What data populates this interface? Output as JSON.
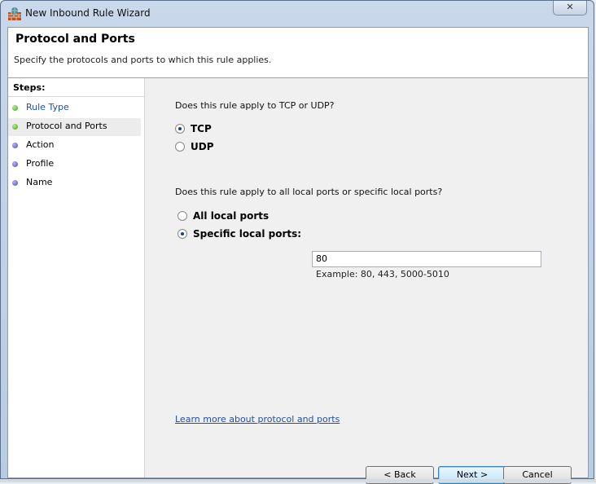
{
  "window": {
    "title": "New Inbound Rule Wizard",
    "close_glyph": "✕"
  },
  "header": {
    "title": "Protocol and Ports",
    "subtitle": "Specify the protocols and ports to which this rule applies."
  },
  "steps": {
    "label": "Steps:",
    "items": [
      {
        "label": "Rule Type",
        "status": "completed",
        "link": true
      },
      {
        "label": "Protocol and Ports",
        "status": "current",
        "link": false
      },
      {
        "label": "Action",
        "status": "pending",
        "link": false
      },
      {
        "label": "Profile",
        "status": "pending",
        "link": false
      },
      {
        "label": "Name",
        "status": "pending",
        "link": false
      }
    ]
  },
  "protocol": {
    "question": "Does this rule apply to TCP or UDP?",
    "options": [
      {
        "label": "TCP",
        "checked": true
      },
      {
        "label": "UDP",
        "checked": false
      }
    ]
  },
  "ports": {
    "question": "Does this rule apply to all local ports or specific local ports?",
    "options": [
      {
        "label": "All local ports",
        "checked": false
      },
      {
        "label": "Specific local ports:",
        "checked": true
      }
    ],
    "value": "80",
    "example": "Example: 80, 443, 5000-5010"
  },
  "learn_more": "Learn more about protocol and ports",
  "buttons": {
    "back": "< Back",
    "next": "Next >",
    "cancel": "Cancel"
  },
  "colors": {
    "link": "#1f4fa6",
    "completed_dot": "#3aa21a",
    "pending_dot": "#4b47b5"
  }
}
